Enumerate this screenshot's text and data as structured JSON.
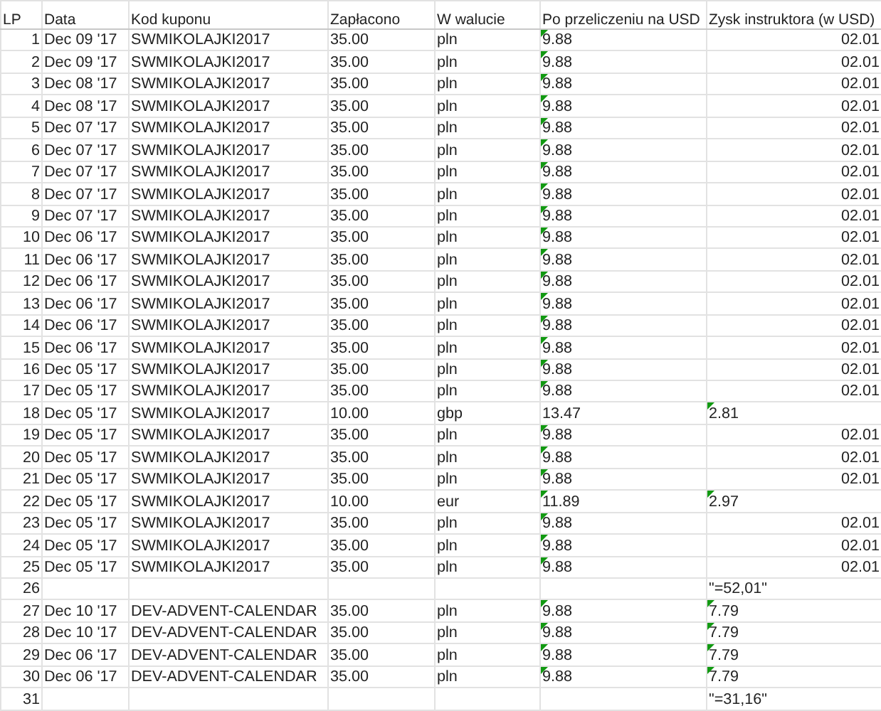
{
  "table": {
    "columns": [
      "LP",
      "Data",
      "Kod kuponu",
      "Zapłacono",
      "W walucie",
      "Po przeliczeniu na USD",
      "Zysk instruktora (w USD)"
    ],
    "rows": [
      {
        "cells": [
          {
            "text": "1",
            "kind": "number"
          },
          {
            "text": "Dec 09 '17",
            "kind": "text"
          },
          {
            "text": "SWMIKOLAJKI2017",
            "kind": "text"
          },
          {
            "text": "35.00",
            "kind": "text"
          },
          {
            "text": "pln",
            "kind": "text"
          },
          {
            "text": "9.88",
            "kind": "text",
            "flag": true
          },
          {
            "text": "02.01",
            "kind": "number",
            "flag": false
          }
        ]
      },
      {
        "cells": [
          {
            "text": "2",
            "kind": "number"
          },
          {
            "text": "Dec 09 '17",
            "kind": "text"
          },
          {
            "text": "SWMIKOLAJKI2017",
            "kind": "text"
          },
          {
            "text": "35.00",
            "kind": "text"
          },
          {
            "text": "pln",
            "kind": "text"
          },
          {
            "text": "9.88",
            "kind": "text",
            "flag": true
          },
          {
            "text": "02.01",
            "kind": "number",
            "flag": false
          }
        ]
      },
      {
        "cells": [
          {
            "text": "3",
            "kind": "number"
          },
          {
            "text": "Dec 08 '17",
            "kind": "text"
          },
          {
            "text": "SWMIKOLAJKI2017",
            "kind": "text"
          },
          {
            "text": "35.00",
            "kind": "text"
          },
          {
            "text": "pln",
            "kind": "text"
          },
          {
            "text": "9.88",
            "kind": "text",
            "flag": true
          },
          {
            "text": "02.01",
            "kind": "number",
            "flag": false
          }
        ]
      },
      {
        "cells": [
          {
            "text": "4",
            "kind": "number"
          },
          {
            "text": "Dec 08 '17",
            "kind": "text"
          },
          {
            "text": "SWMIKOLAJKI2017",
            "kind": "text"
          },
          {
            "text": "35.00",
            "kind": "text"
          },
          {
            "text": "pln",
            "kind": "text"
          },
          {
            "text": "9.88",
            "kind": "text",
            "flag": true
          },
          {
            "text": "02.01",
            "kind": "number",
            "flag": false
          }
        ]
      },
      {
        "cells": [
          {
            "text": "5",
            "kind": "number"
          },
          {
            "text": "Dec 07 '17",
            "kind": "text"
          },
          {
            "text": "SWMIKOLAJKI2017",
            "kind": "text"
          },
          {
            "text": "35.00",
            "kind": "text"
          },
          {
            "text": "pln",
            "kind": "text"
          },
          {
            "text": "9.88",
            "kind": "text",
            "flag": true
          },
          {
            "text": "02.01",
            "kind": "number",
            "flag": false
          }
        ]
      },
      {
        "cells": [
          {
            "text": "6",
            "kind": "number"
          },
          {
            "text": "Dec 07 '17",
            "kind": "text"
          },
          {
            "text": "SWMIKOLAJKI2017",
            "kind": "text"
          },
          {
            "text": "35.00",
            "kind": "text"
          },
          {
            "text": "pln",
            "kind": "text"
          },
          {
            "text": "9.88",
            "kind": "text",
            "flag": true
          },
          {
            "text": "02.01",
            "kind": "number",
            "flag": false
          }
        ]
      },
      {
        "cells": [
          {
            "text": "7",
            "kind": "number"
          },
          {
            "text": "Dec 07 '17",
            "kind": "text"
          },
          {
            "text": "SWMIKOLAJKI2017",
            "kind": "text"
          },
          {
            "text": "35.00",
            "kind": "text"
          },
          {
            "text": "pln",
            "kind": "text"
          },
          {
            "text": "9.88",
            "kind": "text",
            "flag": true
          },
          {
            "text": "02.01",
            "kind": "number",
            "flag": false
          }
        ]
      },
      {
        "cells": [
          {
            "text": "8",
            "kind": "number"
          },
          {
            "text": "Dec 07 '17",
            "kind": "text"
          },
          {
            "text": "SWMIKOLAJKI2017",
            "kind": "text"
          },
          {
            "text": "35.00",
            "kind": "text"
          },
          {
            "text": "pln",
            "kind": "text"
          },
          {
            "text": "9.88",
            "kind": "text",
            "flag": true
          },
          {
            "text": "02.01",
            "kind": "number",
            "flag": false
          }
        ]
      },
      {
        "cells": [
          {
            "text": "9",
            "kind": "number"
          },
          {
            "text": "Dec 07 '17",
            "kind": "text"
          },
          {
            "text": "SWMIKOLAJKI2017",
            "kind": "text"
          },
          {
            "text": "35.00",
            "kind": "text"
          },
          {
            "text": "pln",
            "kind": "text"
          },
          {
            "text": "9.88",
            "kind": "text",
            "flag": true
          },
          {
            "text": "02.01",
            "kind": "number",
            "flag": false
          }
        ]
      },
      {
        "cells": [
          {
            "text": "10",
            "kind": "number"
          },
          {
            "text": "Dec 06 '17",
            "kind": "text"
          },
          {
            "text": "SWMIKOLAJKI2017",
            "kind": "text"
          },
          {
            "text": "35.00",
            "kind": "text"
          },
          {
            "text": "pln",
            "kind": "text"
          },
          {
            "text": "9.88",
            "kind": "text",
            "flag": true
          },
          {
            "text": "02.01",
            "kind": "number",
            "flag": false
          }
        ]
      },
      {
        "cells": [
          {
            "text": "11",
            "kind": "number"
          },
          {
            "text": "Dec 06 '17",
            "kind": "text"
          },
          {
            "text": "SWMIKOLAJKI2017",
            "kind": "text"
          },
          {
            "text": "35.00",
            "kind": "text"
          },
          {
            "text": "pln",
            "kind": "text"
          },
          {
            "text": "9.88",
            "kind": "text",
            "flag": true
          },
          {
            "text": "02.01",
            "kind": "number",
            "flag": false
          }
        ]
      },
      {
        "cells": [
          {
            "text": "12",
            "kind": "number"
          },
          {
            "text": "Dec 06 '17",
            "kind": "text"
          },
          {
            "text": "SWMIKOLAJKI2017",
            "kind": "text"
          },
          {
            "text": "35.00",
            "kind": "text"
          },
          {
            "text": "pln",
            "kind": "text"
          },
          {
            "text": "9.88",
            "kind": "text",
            "flag": true
          },
          {
            "text": "02.01",
            "kind": "number",
            "flag": false
          }
        ]
      },
      {
        "cells": [
          {
            "text": "13",
            "kind": "number"
          },
          {
            "text": "Dec 06 '17",
            "kind": "text"
          },
          {
            "text": "SWMIKOLAJKI2017",
            "kind": "text"
          },
          {
            "text": "35.00",
            "kind": "text"
          },
          {
            "text": "pln",
            "kind": "text"
          },
          {
            "text": "9.88",
            "kind": "text",
            "flag": true
          },
          {
            "text": "02.01",
            "kind": "number",
            "flag": false
          }
        ]
      },
      {
        "cells": [
          {
            "text": "14",
            "kind": "number"
          },
          {
            "text": "Dec 06 '17",
            "kind": "text"
          },
          {
            "text": "SWMIKOLAJKI2017",
            "kind": "text"
          },
          {
            "text": "35.00",
            "kind": "text"
          },
          {
            "text": "pln",
            "kind": "text"
          },
          {
            "text": "9.88",
            "kind": "text",
            "flag": true
          },
          {
            "text": "02.01",
            "kind": "number",
            "flag": false
          }
        ]
      },
      {
        "cells": [
          {
            "text": "15",
            "kind": "number"
          },
          {
            "text": "Dec 06 '17",
            "kind": "text"
          },
          {
            "text": "SWMIKOLAJKI2017",
            "kind": "text"
          },
          {
            "text": "35.00",
            "kind": "text"
          },
          {
            "text": "pln",
            "kind": "text"
          },
          {
            "text": "9.88",
            "kind": "text",
            "flag": true
          },
          {
            "text": "02.01",
            "kind": "number",
            "flag": false
          }
        ]
      },
      {
        "cells": [
          {
            "text": "16",
            "kind": "number"
          },
          {
            "text": "Dec 05 '17",
            "kind": "text"
          },
          {
            "text": "SWMIKOLAJKI2017",
            "kind": "text"
          },
          {
            "text": "35.00",
            "kind": "text"
          },
          {
            "text": "pln",
            "kind": "text"
          },
          {
            "text": "9.88",
            "kind": "text",
            "flag": true
          },
          {
            "text": "02.01",
            "kind": "number",
            "flag": false
          }
        ]
      },
      {
        "cells": [
          {
            "text": "17",
            "kind": "number"
          },
          {
            "text": "Dec 05 '17",
            "kind": "text"
          },
          {
            "text": "SWMIKOLAJKI2017",
            "kind": "text"
          },
          {
            "text": "35.00",
            "kind": "text"
          },
          {
            "text": "pln",
            "kind": "text"
          },
          {
            "text": "9.88",
            "kind": "text",
            "flag": true
          },
          {
            "text": "02.01",
            "kind": "number",
            "flag": false
          }
        ]
      },
      {
        "cells": [
          {
            "text": "18",
            "kind": "number"
          },
          {
            "text": "Dec 05 '17",
            "kind": "text"
          },
          {
            "text": "SWMIKOLAJKI2017",
            "kind": "text"
          },
          {
            "text": "10.00",
            "kind": "text"
          },
          {
            "text": "gbp",
            "kind": "text"
          },
          {
            "text": "13.47",
            "kind": "text",
            "flag": false
          },
          {
            "text": "2.81",
            "kind": "text",
            "flag": true
          }
        ]
      },
      {
        "cells": [
          {
            "text": "19",
            "kind": "number"
          },
          {
            "text": "Dec 05 '17",
            "kind": "text"
          },
          {
            "text": "SWMIKOLAJKI2017",
            "kind": "text"
          },
          {
            "text": "35.00",
            "kind": "text"
          },
          {
            "text": "pln",
            "kind": "text"
          },
          {
            "text": "9.88",
            "kind": "text",
            "flag": true
          },
          {
            "text": "02.01",
            "kind": "number",
            "flag": false
          }
        ]
      },
      {
        "cells": [
          {
            "text": "20",
            "kind": "number"
          },
          {
            "text": "Dec 05 '17",
            "kind": "text"
          },
          {
            "text": "SWMIKOLAJKI2017",
            "kind": "text"
          },
          {
            "text": "35.00",
            "kind": "text"
          },
          {
            "text": "pln",
            "kind": "text"
          },
          {
            "text": "9.88",
            "kind": "text",
            "flag": true
          },
          {
            "text": "02.01",
            "kind": "number",
            "flag": false
          }
        ]
      },
      {
        "cells": [
          {
            "text": "21",
            "kind": "number"
          },
          {
            "text": "Dec 05 '17",
            "kind": "text"
          },
          {
            "text": "SWMIKOLAJKI2017",
            "kind": "text"
          },
          {
            "text": "35.00",
            "kind": "text"
          },
          {
            "text": "pln",
            "kind": "text"
          },
          {
            "text": "9.88",
            "kind": "text",
            "flag": true
          },
          {
            "text": "02.01",
            "kind": "number",
            "flag": false
          }
        ]
      },
      {
        "cells": [
          {
            "text": "22",
            "kind": "number"
          },
          {
            "text": "Dec 05 '17",
            "kind": "text"
          },
          {
            "text": "SWMIKOLAJKI2017",
            "kind": "text"
          },
          {
            "text": "10.00",
            "kind": "text"
          },
          {
            "text": "eur",
            "kind": "text"
          },
          {
            "text": "11.89",
            "kind": "text",
            "flag": true
          },
          {
            "text": "2.97",
            "kind": "text",
            "flag": true
          }
        ]
      },
      {
        "cells": [
          {
            "text": "23",
            "kind": "number"
          },
          {
            "text": "Dec 05 '17",
            "kind": "text"
          },
          {
            "text": "SWMIKOLAJKI2017",
            "kind": "text"
          },
          {
            "text": "35.00",
            "kind": "text"
          },
          {
            "text": "pln",
            "kind": "text"
          },
          {
            "text": "9.88",
            "kind": "text",
            "flag": true
          },
          {
            "text": "02.01",
            "kind": "number",
            "flag": false
          }
        ]
      },
      {
        "cells": [
          {
            "text": "24",
            "kind": "number"
          },
          {
            "text": "Dec 05 '17",
            "kind": "text"
          },
          {
            "text": "SWMIKOLAJKI2017",
            "kind": "text"
          },
          {
            "text": "35.00",
            "kind": "text"
          },
          {
            "text": "pln",
            "kind": "text"
          },
          {
            "text": "9.88",
            "kind": "text",
            "flag": true
          },
          {
            "text": "02.01",
            "kind": "number",
            "flag": false
          }
        ]
      },
      {
        "cells": [
          {
            "text": "25",
            "kind": "number"
          },
          {
            "text": "Dec 05 '17",
            "kind": "text"
          },
          {
            "text": "SWMIKOLAJKI2017",
            "kind": "text"
          },
          {
            "text": "35.00",
            "kind": "text"
          },
          {
            "text": "pln",
            "kind": "text"
          },
          {
            "text": "9.88",
            "kind": "text",
            "flag": true
          },
          {
            "text": "02.01",
            "kind": "number",
            "flag": false
          }
        ]
      },
      {
        "cells": [
          {
            "text": "26",
            "kind": "number"
          },
          {
            "kind": "empty"
          },
          {
            "kind": "empty"
          },
          {
            "kind": "empty"
          },
          {
            "kind": "empty"
          },
          {
            "kind": "empty",
            "flag": false
          },
          {
            "text": "\"=52,01\"",
            "kind": "text",
            "flag": false
          }
        ]
      },
      {
        "cells": [
          {
            "text": "27",
            "kind": "number"
          },
          {
            "text": "Dec 10 '17",
            "kind": "text"
          },
          {
            "text": "DEV-ADVENT-CALENDAR",
            "kind": "text"
          },
          {
            "text": "35.00",
            "kind": "text"
          },
          {
            "text": "pln",
            "kind": "text"
          },
          {
            "text": "9.88",
            "kind": "text",
            "flag": true
          },
          {
            "text": "7.79",
            "kind": "text",
            "flag": true
          }
        ]
      },
      {
        "cells": [
          {
            "text": "28",
            "kind": "number"
          },
          {
            "text": "Dec 10 '17",
            "kind": "text"
          },
          {
            "text": "DEV-ADVENT-CALENDAR",
            "kind": "text"
          },
          {
            "text": "35.00",
            "kind": "text"
          },
          {
            "text": "pln",
            "kind": "text"
          },
          {
            "text": "9.88",
            "kind": "text",
            "flag": true
          },
          {
            "text": "7.79",
            "kind": "text",
            "flag": true
          }
        ]
      },
      {
        "cells": [
          {
            "text": "29",
            "kind": "number"
          },
          {
            "text": "Dec 06 '17",
            "kind": "text"
          },
          {
            "text": "DEV-ADVENT-CALENDAR",
            "kind": "text"
          },
          {
            "text": "35.00",
            "kind": "text"
          },
          {
            "text": "pln",
            "kind": "text"
          },
          {
            "text": "9.88",
            "kind": "text",
            "flag": true
          },
          {
            "text": "7.79",
            "kind": "text",
            "flag": true
          }
        ]
      },
      {
        "cells": [
          {
            "text": "30",
            "kind": "number"
          },
          {
            "text": "Dec 06 '17",
            "kind": "text"
          },
          {
            "text": "DEV-ADVENT-CALENDAR",
            "kind": "text"
          },
          {
            "text": "35.00",
            "kind": "text"
          },
          {
            "text": "pln",
            "kind": "text"
          },
          {
            "text": "9.88",
            "kind": "text",
            "flag": true
          },
          {
            "text": "7.79",
            "kind": "text",
            "flag": true
          }
        ]
      },
      {
        "cells": [
          {
            "text": "31",
            "kind": "number"
          },
          {
            "kind": "empty"
          },
          {
            "kind": "empty"
          },
          {
            "kind": "empty"
          },
          {
            "kind": "empty"
          },
          {
            "kind": "empty",
            "flag": false
          },
          {
            "text": "\"=31,16\"",
            "kind": "text",
            "flag": false
          }
        ]
      }
    ]
  }
}
